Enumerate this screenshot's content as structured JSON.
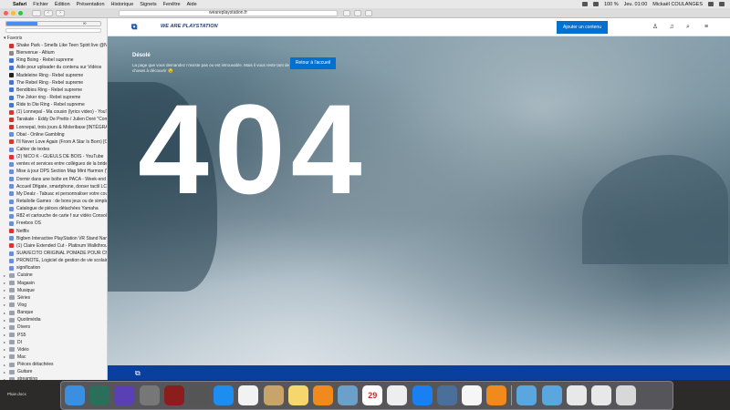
{
  "menubar": {
    "app": "Safari",
    "items": [
      "Fichier",
      "Édition",
      "Présentation",
      "Historique",
      "Signets",
      "Fenêtre",
      "Aide"
    ],
    "battery": "100 %",
    "clock": "Jeu. 01:00",
    "user": "Mickaël COULANGES"
  },
  "toolbar": {
    "url": "weareplaystation.fr"
  },
  "sidebar": {
    "tabs": [
      "",
      "",
      "∞"
    ],
    "header": "Favoris",
    "items": [
      "Shake Park - Smells Like Teen Spirit live @Nickelo...",
      "Bienvenue - Altium",
      "Ring Bsing - Rebel supreme",
      "Aide pour uploader du contenu sur Vidéos",
      "Madeleine Ring - Rebel supreme",
      "The Rebel Ring - Rebel supreme",
      "Bendibios Ring - Rebel supreme",
      "The Joker ring - Rebel supreme",
      "Ride to Die Ring - Rebel supreme",
      "(1) Lonnepal - Ma cousin (lyrics video) - YouTube",
      "Tarakate - Eddy De Pretto / Julien Doré \"Comme...",
      "Lonnepal, trois jours & Moleribase [INTÉGRALE] ...",
      "Obat - Online Gambling",
      "I'll Never Love Again (From A Star Is Born) [Officia...",
      "Cahier de textes",
      "(2) NICO K - GUEULS DE BOIS - YouTube",
      "ventes et services entre collègues de la bride PACA",
      "Mise à jour DPS Section Map Mint Harmon (Version...",
      "Dormir dans une boîte en PACA - Week-end insolit...",
      "Accueil Dfigate, smartphone, dorser tactil LCD po...",
      "My Dealz - Tabuac et personnaliser votre coutaux...",
      "Retailolie Games : de bons jeux ou de simples ess...",
      "Catalogue de pièces détachées Yamaha",
      "R82 et cartouche de carte f sur vidéo Console po...",
      "Freebox OS",
      "Netflix",
      "Bigben Interactive PlayStation VR Stand Nangama...",
      "(1) Claire Extended Cut - Platinum Walkthrough ...",
      "SUAVECITO ORIGINAL POMADE POUR CHEVEUX...",
      "PRONOTE, Logiciel de gestion de vie scolaire.",
      "signification"
    ],
    "folders": [
      "Cuisine",
      "Magasin",
      "Musique",
      "Séries",
      "Vlog",
      "Banque",
      "Quotimédia",
      "Divers",
      "PS5",
      "DI",
      "Vidéo",
      "Mac",
      "Pièces détachées",
      "Guitare",
      "streaming"
    ]
  },
  "page": {
    "brand": "WE ARE PLAYSTATION",
    "add_button": "Ajouter un contenu",
    "sorry_title": "Désolé",
    "sorry_message": "La page que vous demandez n'existe pas ou est introuvable. Mais il vous reste tant de choses à découvrir 😉",
    "back_button": "Retour à l'accueil",
    "error_code": "404"
  },
  "desktop": {
    "label": "Pluie.docx"
  },
  "dock": {
    "calendar_day": "29",
    "apps": [
      "finder-icon",
      "dashboard-icon",
      "siri-icon",
      "system-preferences-icon",
      "photo-booth-icon",
      "launchpad-icon",
      "app-store-icon",
      "photos-icon",
      "contacts-icon",
      "notes-icon",
      "books-icon",
      "preview-icon",
      "calendar-icon",
      "chrome-icon",
      "safari-icon",
      "screenshot-icon",
      "itunes-icon",
      "vlc-icon",
      "downloads-folder-icon",
      "folder-icon",
      "document-icon",
      "document2-icon",
      "trash-icon"
    ]
  }
}
